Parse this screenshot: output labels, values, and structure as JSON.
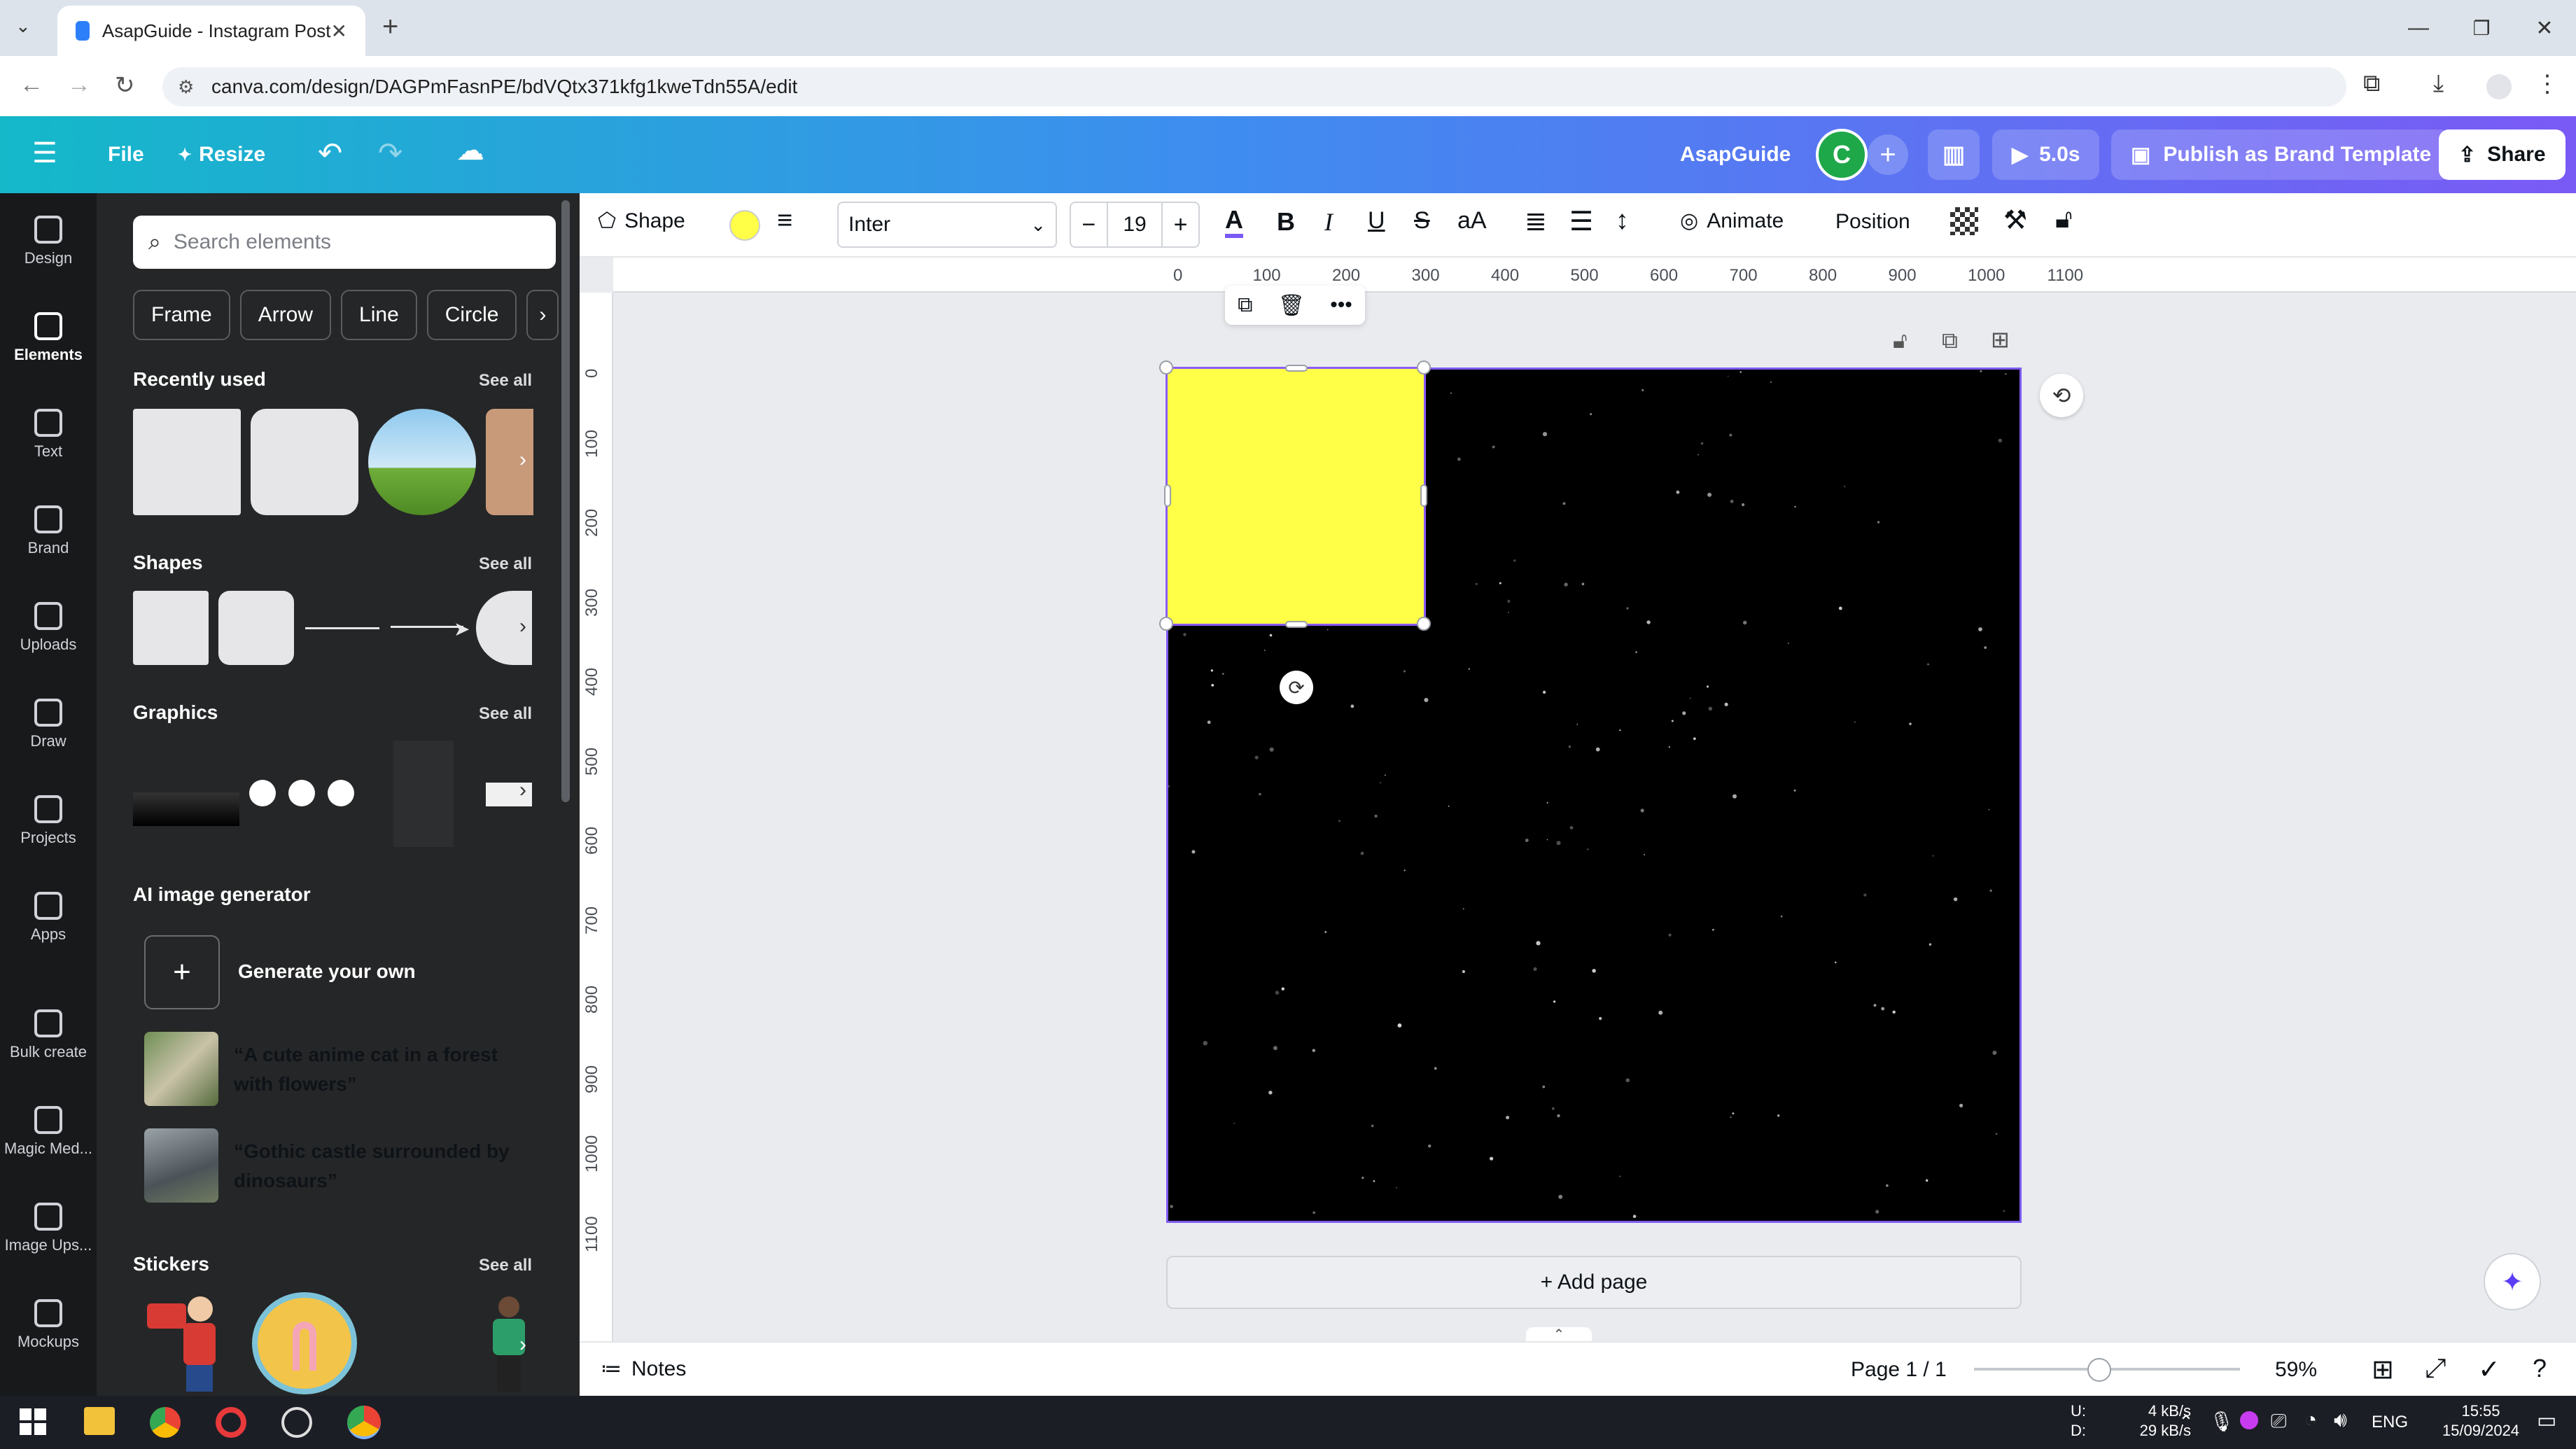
{
  "browser": {
    "tab_title": "AsapGuide - Instagram Post",
    "url": "canva.com/design/DAGPmFasnPE/bdVQtx371kfg1kweTdn55A/edit"
  },
  "header": {
    "file": "File",
    "resize": "Resize",
    "team_name": "AsapGuide",
    "avatar_letter": "C",
    "present_time": "5.0s",
    "publish": "Publish as Brand Template",
    "share": "Share"
  },
  "rail": [
    {
      "label": "Design",
      "icon": "design-icon"
    },
    {
      "label": "Elements",
      "icon": "elements-icon",
      "active": true
    },
    {
      "label": "Text",
      "icon": "text-icon"
    },
    {
      "label": "Brand",
      "icon": "brand-icon"
    },
    {
      "label": "Uploads",
      "icon": "uploads-icon"
    },
    {
      "label": "Draw",
      "icon": "draw-icon"
    },
    {
      "label": "Projects",
      "icon": "projects-icon"
    },
    {
      "label": "Apps",
      "icon": "apps-icon"
    },
    {
      "label": "Bulk create",
      "icon": "bulk-create-icon"
    },
    {
      "label": "Magic Med...",
      "icon": "magic-media-icon"
    },
    {
      "label": "Image Ups...",
      "icon": "image-upscaler-icon"
    },
    {
      "label": "Mockups",
      "icon": "mockups-icon"
    }
  ],
  "panel": {
    "search_placeholder": "Search elements",
    "chips": [
      "Frame",
      "Arrow",
      "Line",
      "Circle"
    ],
    "recently_used": "Recently used",
    "shapes": "Shapes",
    "graphics": "Graphics",
    "ai_generator": "AI image generator",
    "generate_own": "Generate your own",
    "prompt1": "“A cute anime cat in a forest with flowers”",
    "prompt2": "“Gothic castle surrounded by dinosaurs”",
    "stickers": "Stickers",
    "see_all": "See all"
  },
  "toolbar": {
    "shape": "Shape",
    "fill_color": "#ffff47",
    "font": "Inter",
    "font_size": "19",
    "case": "aA",
    "animate": "Animate",
    "position": "Position"
  },
  "rulers": {
    "h": [
      "0",
      "100",
      "200",
      "300",
      "400",
      "500",
      "600",
      "700",
      "800",
      "900",
      "1000",
      "1100"
    ],
    "v": [
      "0",
      "100",
      "200",
      "300",
      "400",
      "500",
      "600",
      "700",
      "800",
      "900",
      "1000",
      "1100"
    ]
  },
  "canvas": {
    "add_page": "+ Add page"
  },
  "footer": {
    "notes": "Notes",
    "page": "Page 1 / 1",
    "zoom": "59%"
  },
  "taskbar": {
    "upload_label": "U:",
    "download_label": "D:",
    "upload": "4 kB/s",
    "download": "29 kB/s",
    "lang": "ENG",
    "time": "15:55",
    "date": "15/09/2024"
  }
}
